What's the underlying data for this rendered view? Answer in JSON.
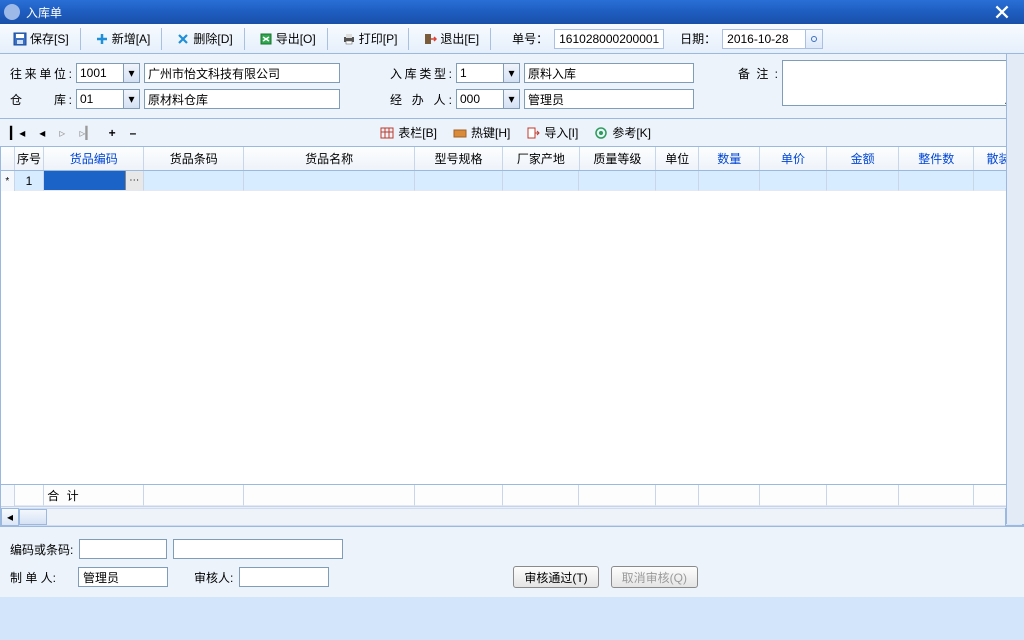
{
  "window": {
    "title": "入库单"
  },
  "toolbar": {
    "save": "保存[S]",
    "add": "新增[A]",
    "delete": "删除[D]",
    "export": "导出[O]",
    "print": "打印[P]",
    "exit": "退出[E]",
    "docno_label": "单号：",
    "docno": "161028000200001",
    "date_label": "日期：",
    "date": "2016-10-28"
  },
  "form": {
    "vendor_label": "往来单位:",
    "vendor_code": "1001",
    "vendor_name": "广州市怡文科技有限公司",
    "intype_label": "入库类型:",
    "intype_code": "1",
    "intype_name": "原料入库",
    "warehouse_label": "仓　　库:",
    "warehouse_code": "01",
    "warehouse_name": "原材料仓库",
    "handler_label": "经 办 人:",
    "handler_code": "000",
    "handler_name": "管理员",
    "remark_label": "备注:"
  },
  "navbar": {
    "biaolan": "表栏[B]",
    "rejian": "热键[H]",
    "daoru": "导入[I]",
    "cankao": "参考[K]"
  },
  "grid": {
    "columns": [
      "序号",
      "货品编码",
      "货品条码",
      "货品名称",
      "型号规格",
      "厂家产地",
      "质量等级",
      "单位",
      "数量",
      "单价",
      "金额",
      "整件数",
      "散装"
    ],
    "blue_cols": [
      1,
      8,
      9,
      10,
      11,
      12
    ],
    "row1_seq": "1",
    "total_label": "合  计"
  },
  "bottom": {
    "barcode_label": "编码或条码:",
    "maker_label": "制 单 人:",
    "maker": "管理员",
    "auditor_label": "审核人:",
    "approve": "审核通过(T)",
    "unapprove": "取消审核(Q)"
  }
}
